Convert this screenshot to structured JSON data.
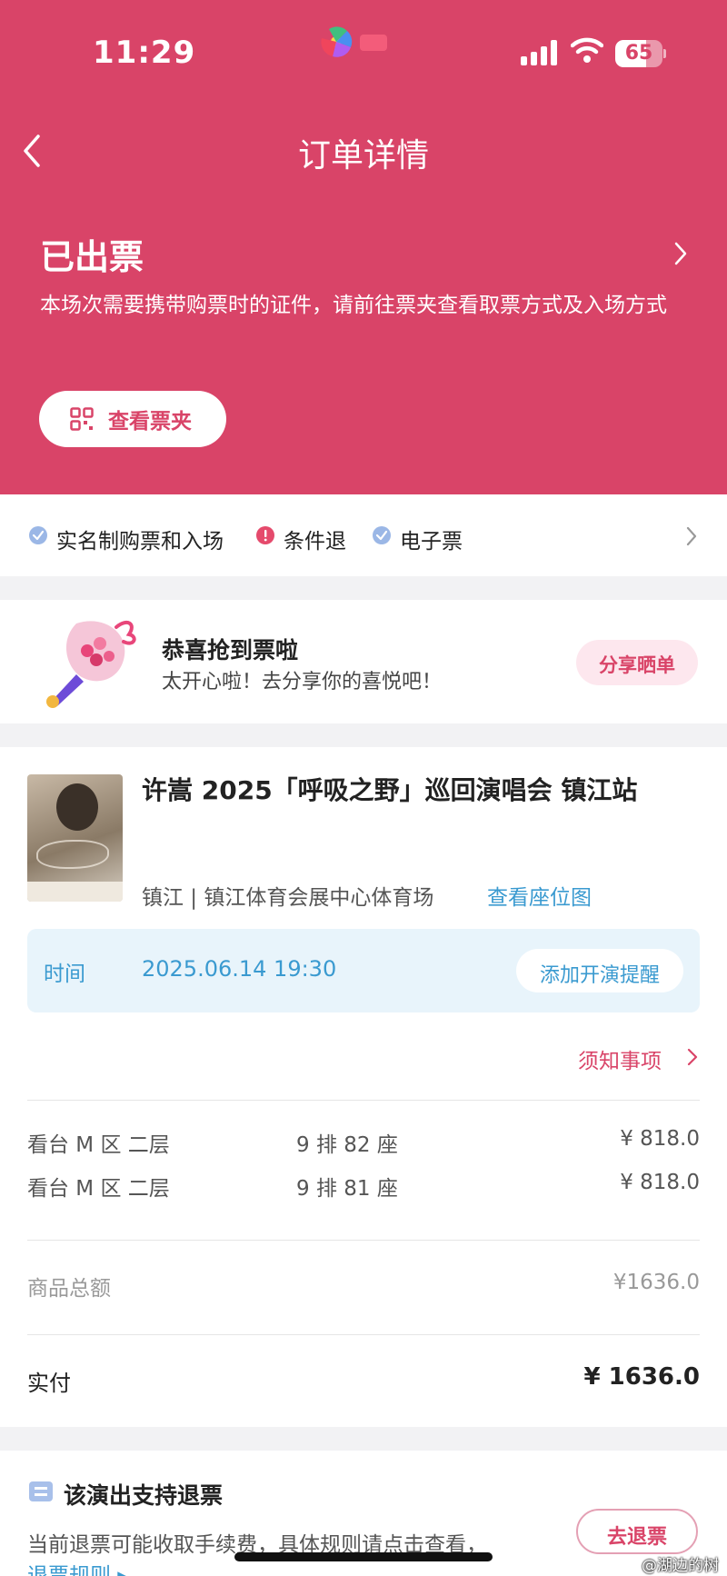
{
  "status_bar": {
    "time": "11:29",
    "battery": "65",
    "battery_level": 0.65,
    "icons": [
      "signal-icon",
      "wifi-icon",
      "battery-icon"
    ]
  },
  "nav": {
    "title": "订单详情",
    "back_icon": "chevron-left-icon"
  },
  "order_status": {
    "title": "已出票",
    "description": "本场次需要携带购票时的证件，请前往票夹查看取票方式及入场方式",
    "folder_button": "查看票夹"
  },
  "tags": [
    {
      "label": "实名制购票和入场",
      "icon": "check-icon"
    },
    {
      "label": "条件退",
      "icon": "alert-icon"
    },
    {
      "label": "电子票",
      "icon": "check-icon"
    }
  ],
  "promo": {
    "title": "恭喜抢到票啦",
    "subtitle": "太开心啦！去分享你的喜悦吧！",
    "share_button": "分享晒单"
  },
  "show": {
    "title": "许嵩 2025「呼吸之野」巡回演唱会 镇江站",
    "venue": "镇江 | 镇江体育会展中心体育场",
    "seatmap_link": "查看座位图",
    "time_label": "时间",
    "time_value": "2025.06.14 19:30",
    "remind_button": "添加开演提醒",
    "notice_link": "须知事项"
  },
  "tickets": [
    {
      "area": "看台 M 区 二层",
      "seat": "9 排 82 座",
      "price": "¥ 818.0"
    },
    {
      "area": "看台 M 区 二层",
      "seat": "9 排 81 座",
      "price": "¥ 818.0"
    }
  ],
  "totals": {
    "goods_label": "商品总额",
    "goods_value": "¥1636.0",
    "paid_label": "实付",
    "paid_value": "¥ 1636.0"
  },
  "refund": {
    "title": "该演出支持退票",
    "description": "当前退票可能收取手续费，具体规则请点击查看，",
    "rule_link": "退票规则 ▸",
    "button": "去退票"
  },
  "watermark": "@湖边的树",
  "colors": {
    "brand": "#d94468",
    "link": "#3a9ad0",
    "time_box_bg": "#e8f4fb"
  }
}
